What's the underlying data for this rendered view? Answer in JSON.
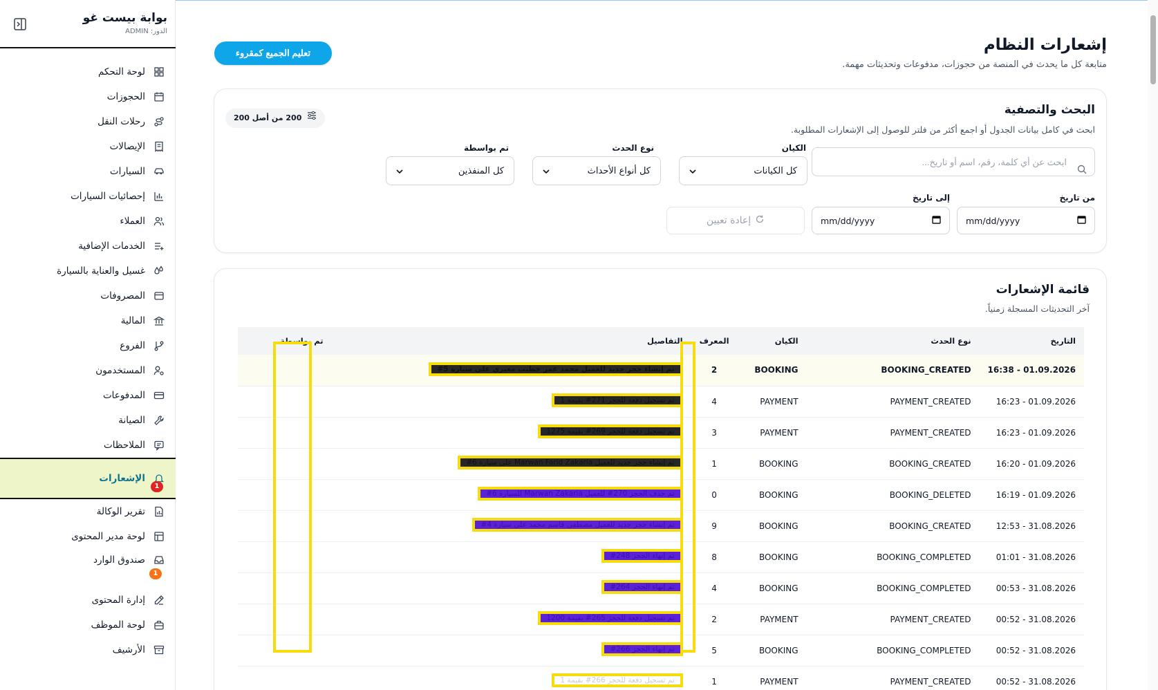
{
  "app": {
    "title": "بوابة بيست غو",
    "role": "الدور: ADMIN"
  },
  "sidebar": {
    "items": [
      {
        "label": "لوحة التحكم",
        "icon": "dashboard-icon"
      },
      {
        "label": "الحجوزات",
        "icon": "calendar-icon"
      },
      {
        "label": "رحلات النقل",
        "icon": "route-icon"
      },
      {
        "label": "الإيصالات",
        "icon": "receipt-icon"
      },
      {
        "label": "السيارات",
        "icon": "car-icon"
      },
      {
        "label": "إحصائيات السيارات",
        "icon": "bar-chart-icon"
      },
      {
        "label": "العملاء",
        "icon": "users-icon"
      },
      {
        "label": "الخدمات الإضافية",
        "icon": "list-plus-icon"
      },
      {
        "label": "غسيل والعناية بالسيارة",
        "icon": "droplets-icon"
      },
      {
        "label": "المصروفات",
        "icon": "wallet-icon"
      },
      {
        "label": "المالية",
        "icon": "bank-icon"
      },
      {
        "label": "الفروع",
        "icon": "git-branch-icon"
      },
      {
        "label": "المستخدمون",
        "icon": "user-cog-icon"
      },
      {
        "label": "المدفوعات",
        "icon": "credit-card-icon"
      },
      {
        "label": "الصيانة",
        "icon": "wrench-icon"
      },
      {
        "label": "الملاحظات",
        "icon": "message-icon"
      },
      {
        "label": "الإشعارات",
        "icon": "bell-icon",
        "badge": "1"
      },
      {
        "label": "تقرير الوكالة",
        "icon": "file-chart-icon"
      },
      {
        "label": "لوحة مدير المحتوى",
        "icon": "layout-icon"
      },
      {
        "label": "صندوق الوارد",
        "icon": "inbox-icon",
        "badge": "1"
      },
      {
        "label": "إدارة المحتوى",
        "icon": "pen-icon"
      },
      {
        "label": "لوحة الموظف",
        "icon": "briefcase-icon"
      },
      {
        "label": "الأرشيف",
        "icon": "archive-icon"
      }
    ]
  },
  "page": {
    "title": "إشعارات النظام",
    "subtitle": "متابعة كل ما يحدث في المنصة من حجوزات، مدفوعات وتحديثات مهمة.",
    "mark_all": "تعليم الجميع كمقروء"
  },
  "filters": {
    "title": "البحث والتصفية",
    "subtitle": "ابحث في كامل بيانات الجدول أو اجمع أكثر من فلتر للوصول إلى الإشعارات المطلوبة.",
    "count": "200 من أصل 200",
    "search_placeholder": "ابحث عن أي كلمة، رقم، اسم أو تاريخ...",
    "entity_label": "الكيان",
    "entity_value": "كل الكيانات",
    "event_label": "نوع الحدث",
    "event_value": "كل أنواع الأحداث",
    "by_label": "تم بواسطة",
    "by_value": "كل المنفذين",
    "from_label": "من تاريخ",
    "to_label": "إلى تاريخ",
    "date_placeholder": "mm/dd/yyyy",
    "reset": "إعادة تعيين"
  },
  "list": {
    "title": "قائمة الإشعارات",
    "subtitle": "آخر التحديثات المسجلة زمنياً.",
    "columns": [
      "التاريخ",
      "نوع الحدث",
      "الكيان",
      "المعرف",
      "التفاصيل",
      "تم بواسطة"
    ],
    "rows": [
      {
        "date": "16:38 - 01.09.2026",
        "event": "BOOKING_CREATED",
        "entity": "BOOKING",
        "id": "2",
        "details": "تم إنشاء حجز جديد للعميل محمد عمر خطيب مغيري على سيارة 5#",
        "style": "dark"
      },
      {
        "date": "16:23 - 01.09.2026",
        "event": "PAYMENT_CREATED",
        "entity": "PAYMENT",
        "id": "4",
        "details": "تم تسجيل دفعة للحجز 271# بقيمة 1",
        "style": "dark"
      },
      {
        "date": "16:23 - 01.09.2026",
        "event": "PAYMENT_CREATED",
        "entity": "PAYMENT",
        "id": "3",
        "details": "تم تسجيل دفعة للحجز 269# بقيمة 1275",
        "style": "dark"
      },
      {
        "date": "16:20 - 01.09.2026",
        "event": "BOOKING_CREATED",
        "entity": "BOOKING",
        "id": "1",
        "details": "تم إنشاء حجز جديد للعميل Marwan Farid Zakaria على سيارة 6#",
        "style": "dark"
      },
      {
        "date": "16:19 - 01.09.2026",
        "event": "BOOKING_DELETED",
        "entity": "BOOKING",
        "id": "0",
        "details": "تم حذف الحجز 270# للعميل Marwan Zakaria للسيارة 6#",
        "style": "purple"
      },
      {
        "date": "12:53 - 31.08.2026",
        "event": "BOOKING_CREATED",
        "entity": "BOOKING",
        "id": "9",
        "details": "تم إنشاء حجز جديد للعميل مصطفى قاسم محمد على سيارة 4#",
        "style": "purple"
      },
      {
        "date": "01:01 - 31.08.2026",
        "event": "BOOKING_COMPLETED",
        "entity": "BOOKING",
        "id": "8",
        "details": "تم إنهاء الحجز 248#",
        "style": "purple"
      },
      {
        "date": "00:53 - 31.08.2026",
        "event": "BOOKING_COMPLETED",
        "entity": "BOOKING",
        "id": "4",
        "details": "تم إنهاء الحجز 264#",
        "style": "purple"
      },
      {
        "date": "00:52 - 31.08.2026",
        "event": "PAYMENT_CREATED",
        "entity": "PAYMENT",
        "id": "2",
        "details": "تم تسجيل دفعة للحجز 265# بقيمة 1200",
        "style": "purple"
      },
      {
        "date": "00:52 - 31.08.2026",
        "event": "BOOKING_COMPLETED",
        "entity": "BOOKING",
        "id": "5",
        "details": "تم إنهاء الحجز 266#",
        "style": "purple"
      },
      {
        "date": "00:52 - 31.08.2026",
        "event": "PAYMENT_CREATED",
        "entity": "PAYMENT",
        "id": "1",
        "details": "تم تسجيل دفعة للحجز 266# بقيمة 1",
        "style": "white"
      }
    ]
  },
  "colors": {
    "accent": "#0ea5e9",
    "active_bg": "#eef6c9",
    "redaction": "#f6dc0c"
  }
}
